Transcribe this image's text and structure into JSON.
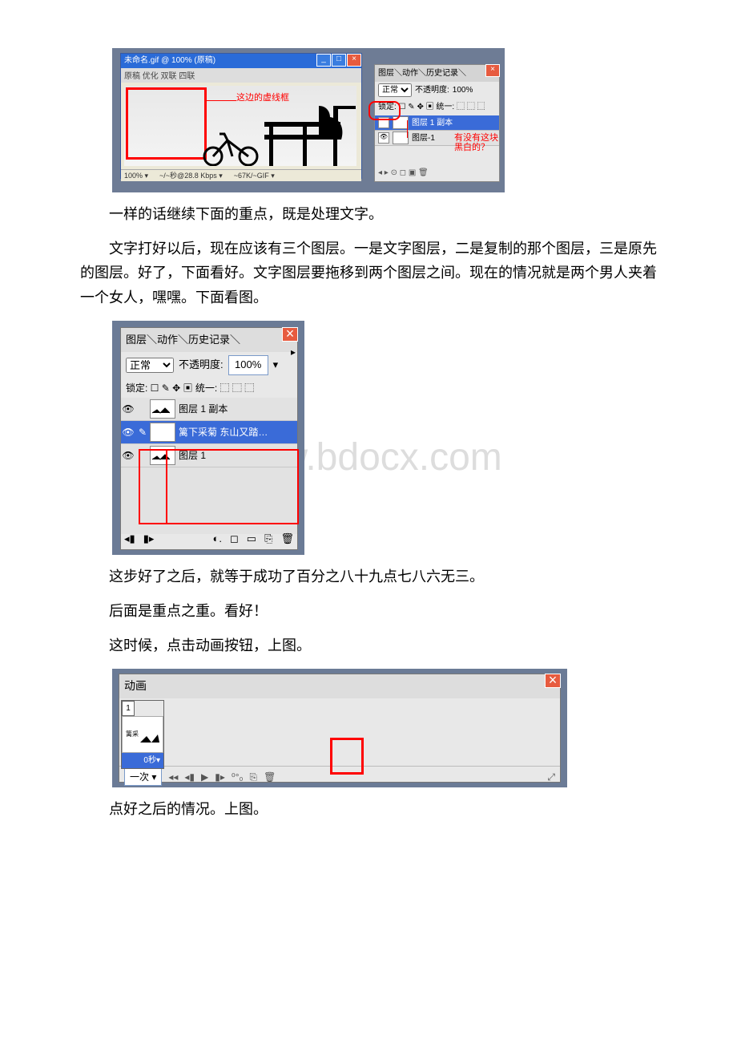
{
  "para1": "一样的话继续下面的重点，既是处理文字。",
  "para2": "文字打好以后，现在应该有三个图层。一是文字图层，二是复制的那个图层，三是原先的图层。好了，下面看好。文字图层要拖移到两个图层之间。现在的情况就是两个男人夹着一个女人，嘿嘿。下面看图。",
  "para3": "这步好了之后，就等于成功了百分之八十九点七八六无三。",
  "para4": "后面是重点之重。看好！",
  "para5": "这时候，点击动画按钮，上图。",
  "para6": "点好之后的情况。上图。",
  "watermark": "www.bdocx.com",
  "fig1": {
    "title": "未命名.gif @ 100% (原稿)",
    "tabs": "原稿  优化  双联  四联",
    "annot_arrow": "这边的虚线框",
    "status_zoom": "100% ▾",
    "status_mid": "~/~秒@28.8 Kbps ▾",
    "status_right": "~67K/~GIF ▾",
    "lp_tabs": "图层＼动作＼历史记录＼",
    "lp_mode": "正常",
    "lp_opac_label": "不透明度:",
    "lp_opac_val": "100%",
    "lp_lock": "锁定: ☐ ✎ ✥ ▣  统一: ⬚ ⬚ ⬚",
    "lp_layer1": "图层 1 副本",
    "lp_layer2": "图层-1",
    "annot_bw1": "有没有这块",
    "annot_bw2": "黑白的？"
  },
  "fig2": {
    "tabs": "图层＼动作＼历史记录＼",
    "mode": "正常",
    "opac_label": "不透明度:",
    "opac_val": "100%",
    "lock": "锁定: ☐ ✎ ✥ ▣  统一: ⬚ ⬚ ⬚",
    "layer1": "图层 1 副本",
    "layer2": "篱下采菊 东山又踏…",
    "layer3": "图层 1",
    "t_icon": "T"
  },
  "fig3": {
    "tab": "动画",
    "frame_num": "1",
    "frame_dur": "0秒▾",
    "loop": "一次 ▾"
  }
}
